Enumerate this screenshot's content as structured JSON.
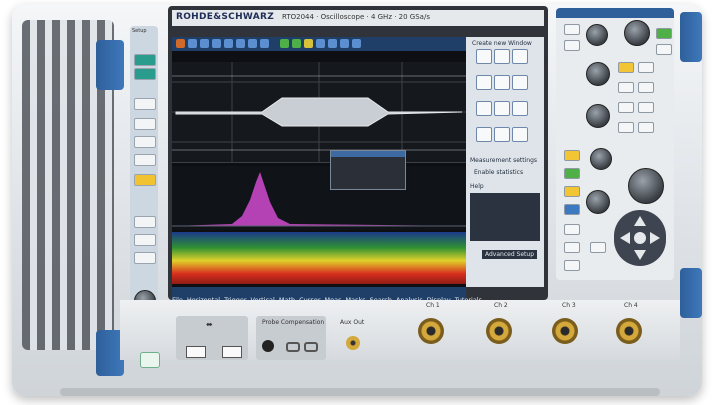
{
  "device": {
    "brand": "ROHDE&SCHWARZ",
    "model": "RTO2044 · Oscilloscope · 4 GHz · 20 GSa/s",
    "left_panel": {
      "title": "Setup"
    }
  },
  "screen": {
    "menu_bar": [
      "File",
      "Horizontal",
      "Trigger",
      "Vertical",
      "Math",
      "Cursor",
      "Meas",
      "Masks",
      "Search",
      "Analysis",
      "Display",
      "Tutorials"
    ],
    "right_panel": {
      "title": "Create new Window",
      "section_measurement": "Measurement settings",
      "enable_statistics": "Enable statistics",
      "help_label": "Help",
      "advanced_setup": "Advanced Setup"
    }
  },
  "front": {
    "channels": [
      "Ch 1",
      "Ch 2",
      "Ch 3",
      "Ch 4"
    ],
    "probe_label": "Probe Compensation",
    "aux_label": "Aux Out",
    "usb_icon": "usb-icon"
  },
  "colors": {
    "accent": "#2e5f9a",
    "ui_bar": "#1f3f68",
    "bnc_gold": "#d4a83a"
  }
}
